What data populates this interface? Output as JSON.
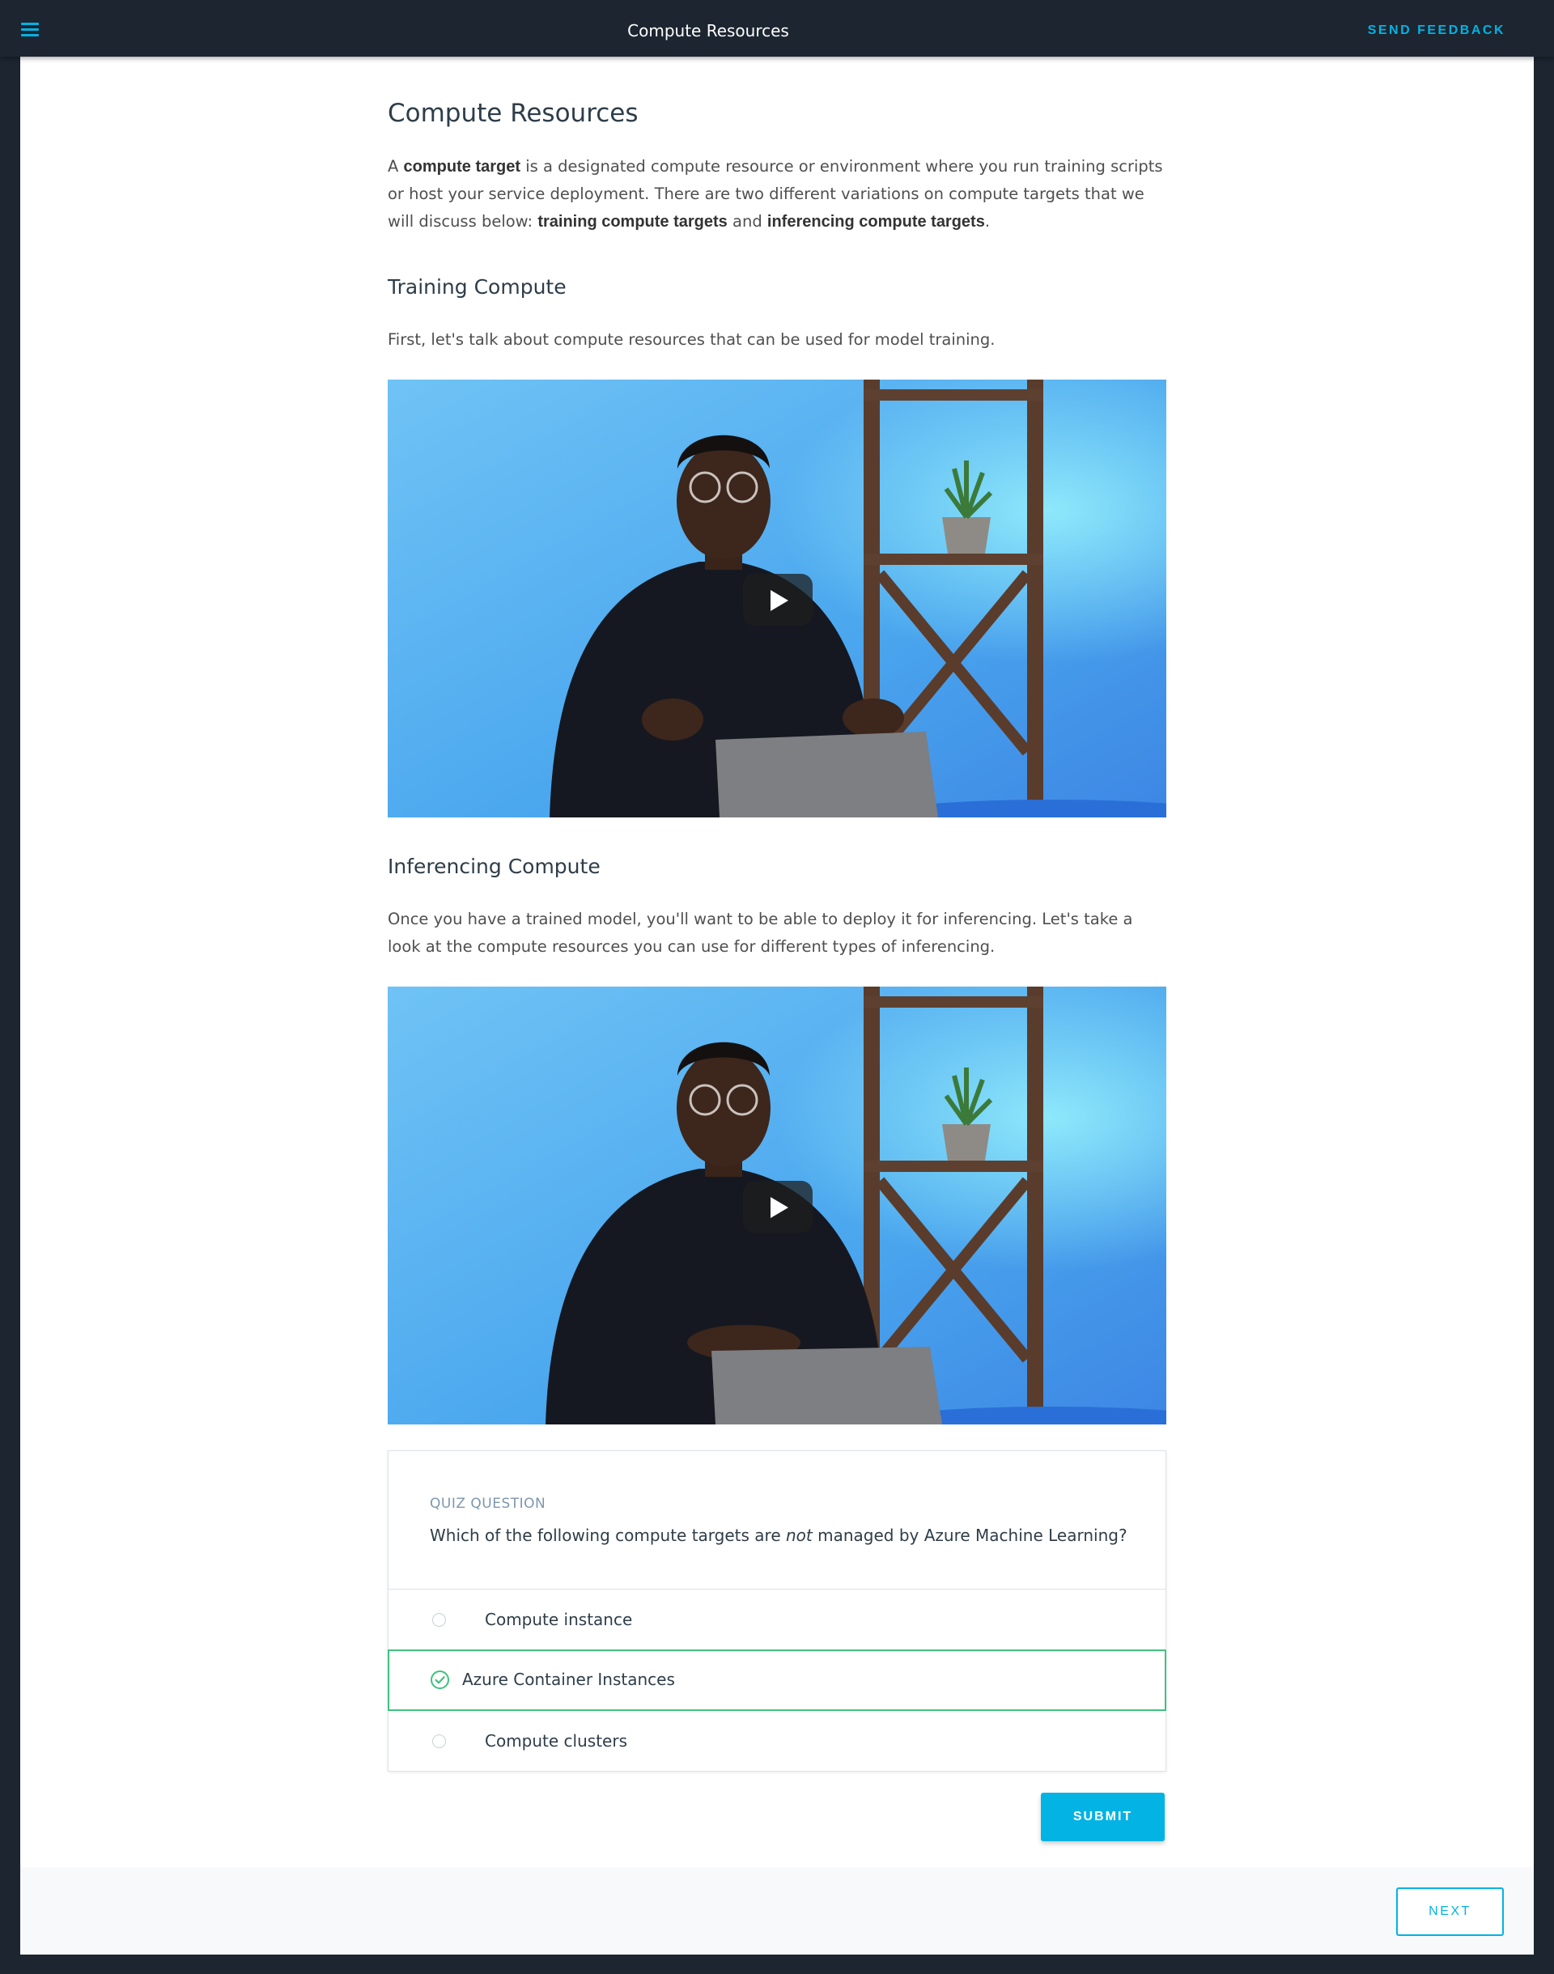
{
  "topbar": {
    "menu_icon": "hamburger-menu-icon",
    "title": "Compute Resources",
    "feedback_label": "SEND FEEDBACK",
    "accent_color": "#02b3e4"
  },
  "lesson": {
    "title": "Compute Resources",
    "intro": {
      "p1": "A ",
      "b1": "compute target",
      "p2": " is a designated compute resource or environment where you run training scripts or host your service deployment. There are two different variations on compute targets that we will discuss below: ",
      "b2": "training compute targets",
      "p3": " and ",
      "b3": "inferencing compute targets",
      "p4": "."
    },
    "training": {
      "heading": "Training Compute",
      "text": "First, let's talk about compute resources that can be used for model training.",
      "video_icon": "play-icon"
    },
    "inferencing": {
      "heading": "Inferencing Compute",
      "text": "Once you have a trained model, you'll want to be able to deploy it for inferencing. Let's take a look at the compute resources you can use for different types of inferencing.",
      "video_icon": "play-icon"
    }
  },
  "quiz": {
    "label": "QUIZ QUESTION",
    "question_pre": "Which of the following compute targets are ",
    "question_em": "not",
    "question_post": " managed by Azure Machine Learning?",
    "options": [
      {
        "label": "Compute instance",
        "selected": false
      },
      {
        "label": "Azure Container Instances",
        "selected": true
      },
      {
        "label": "Compute clusters",
        "selected": false
      }
    ],
    "selected_color": "#3ec37e",
    "submit_label": "SUBMIT"
  },
  "footer": {
    "next_label": "NEXT"
  }
}
